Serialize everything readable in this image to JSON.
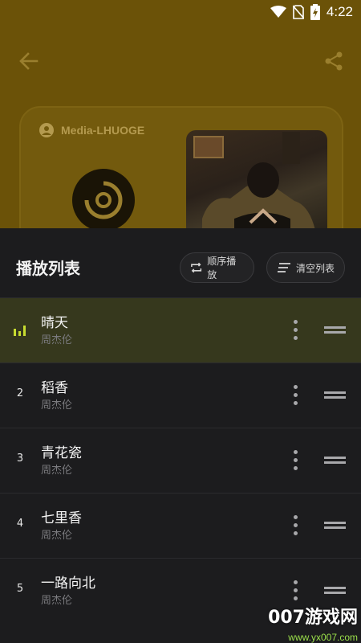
{
  "status_bar": {
    "time": "4:22"
  },
  "player": {
    "username": "Media-LHUOGE",
    "colors": {
      "background": "#6b5208",
      "accent": "#c8dc30"
    }
  },
  "playlist": {
    "title": "播放列表",
    "order_button": "顺序播放",
    "clear_button": "清空列表",
    "songs": [
      {
        "number": "",
        "title": "晴天",
        "artist": "周杰伦",
        "playing": true
      },
      {
        "number": "2",
        "title": "稻香",
        "artist": "周杰伦",
        "playing": false
      },
      {
        "number": "3",
        "title": "青花瓷",
        "artist": "周杰伦",
        "playing": false
      },
      {
        "number": "4",
        "title": "七里香",
        "artist": "周杰伦",
        "playing": false
      },
      {
        "number": "5",
        "title": "一路向北",
        "artist": "周杰伦",
        "playing": false
      }
    ]
  },
  "watermark": {
    "text": "007游戏网",
    "url": "www.yx007.com"
  }
}
